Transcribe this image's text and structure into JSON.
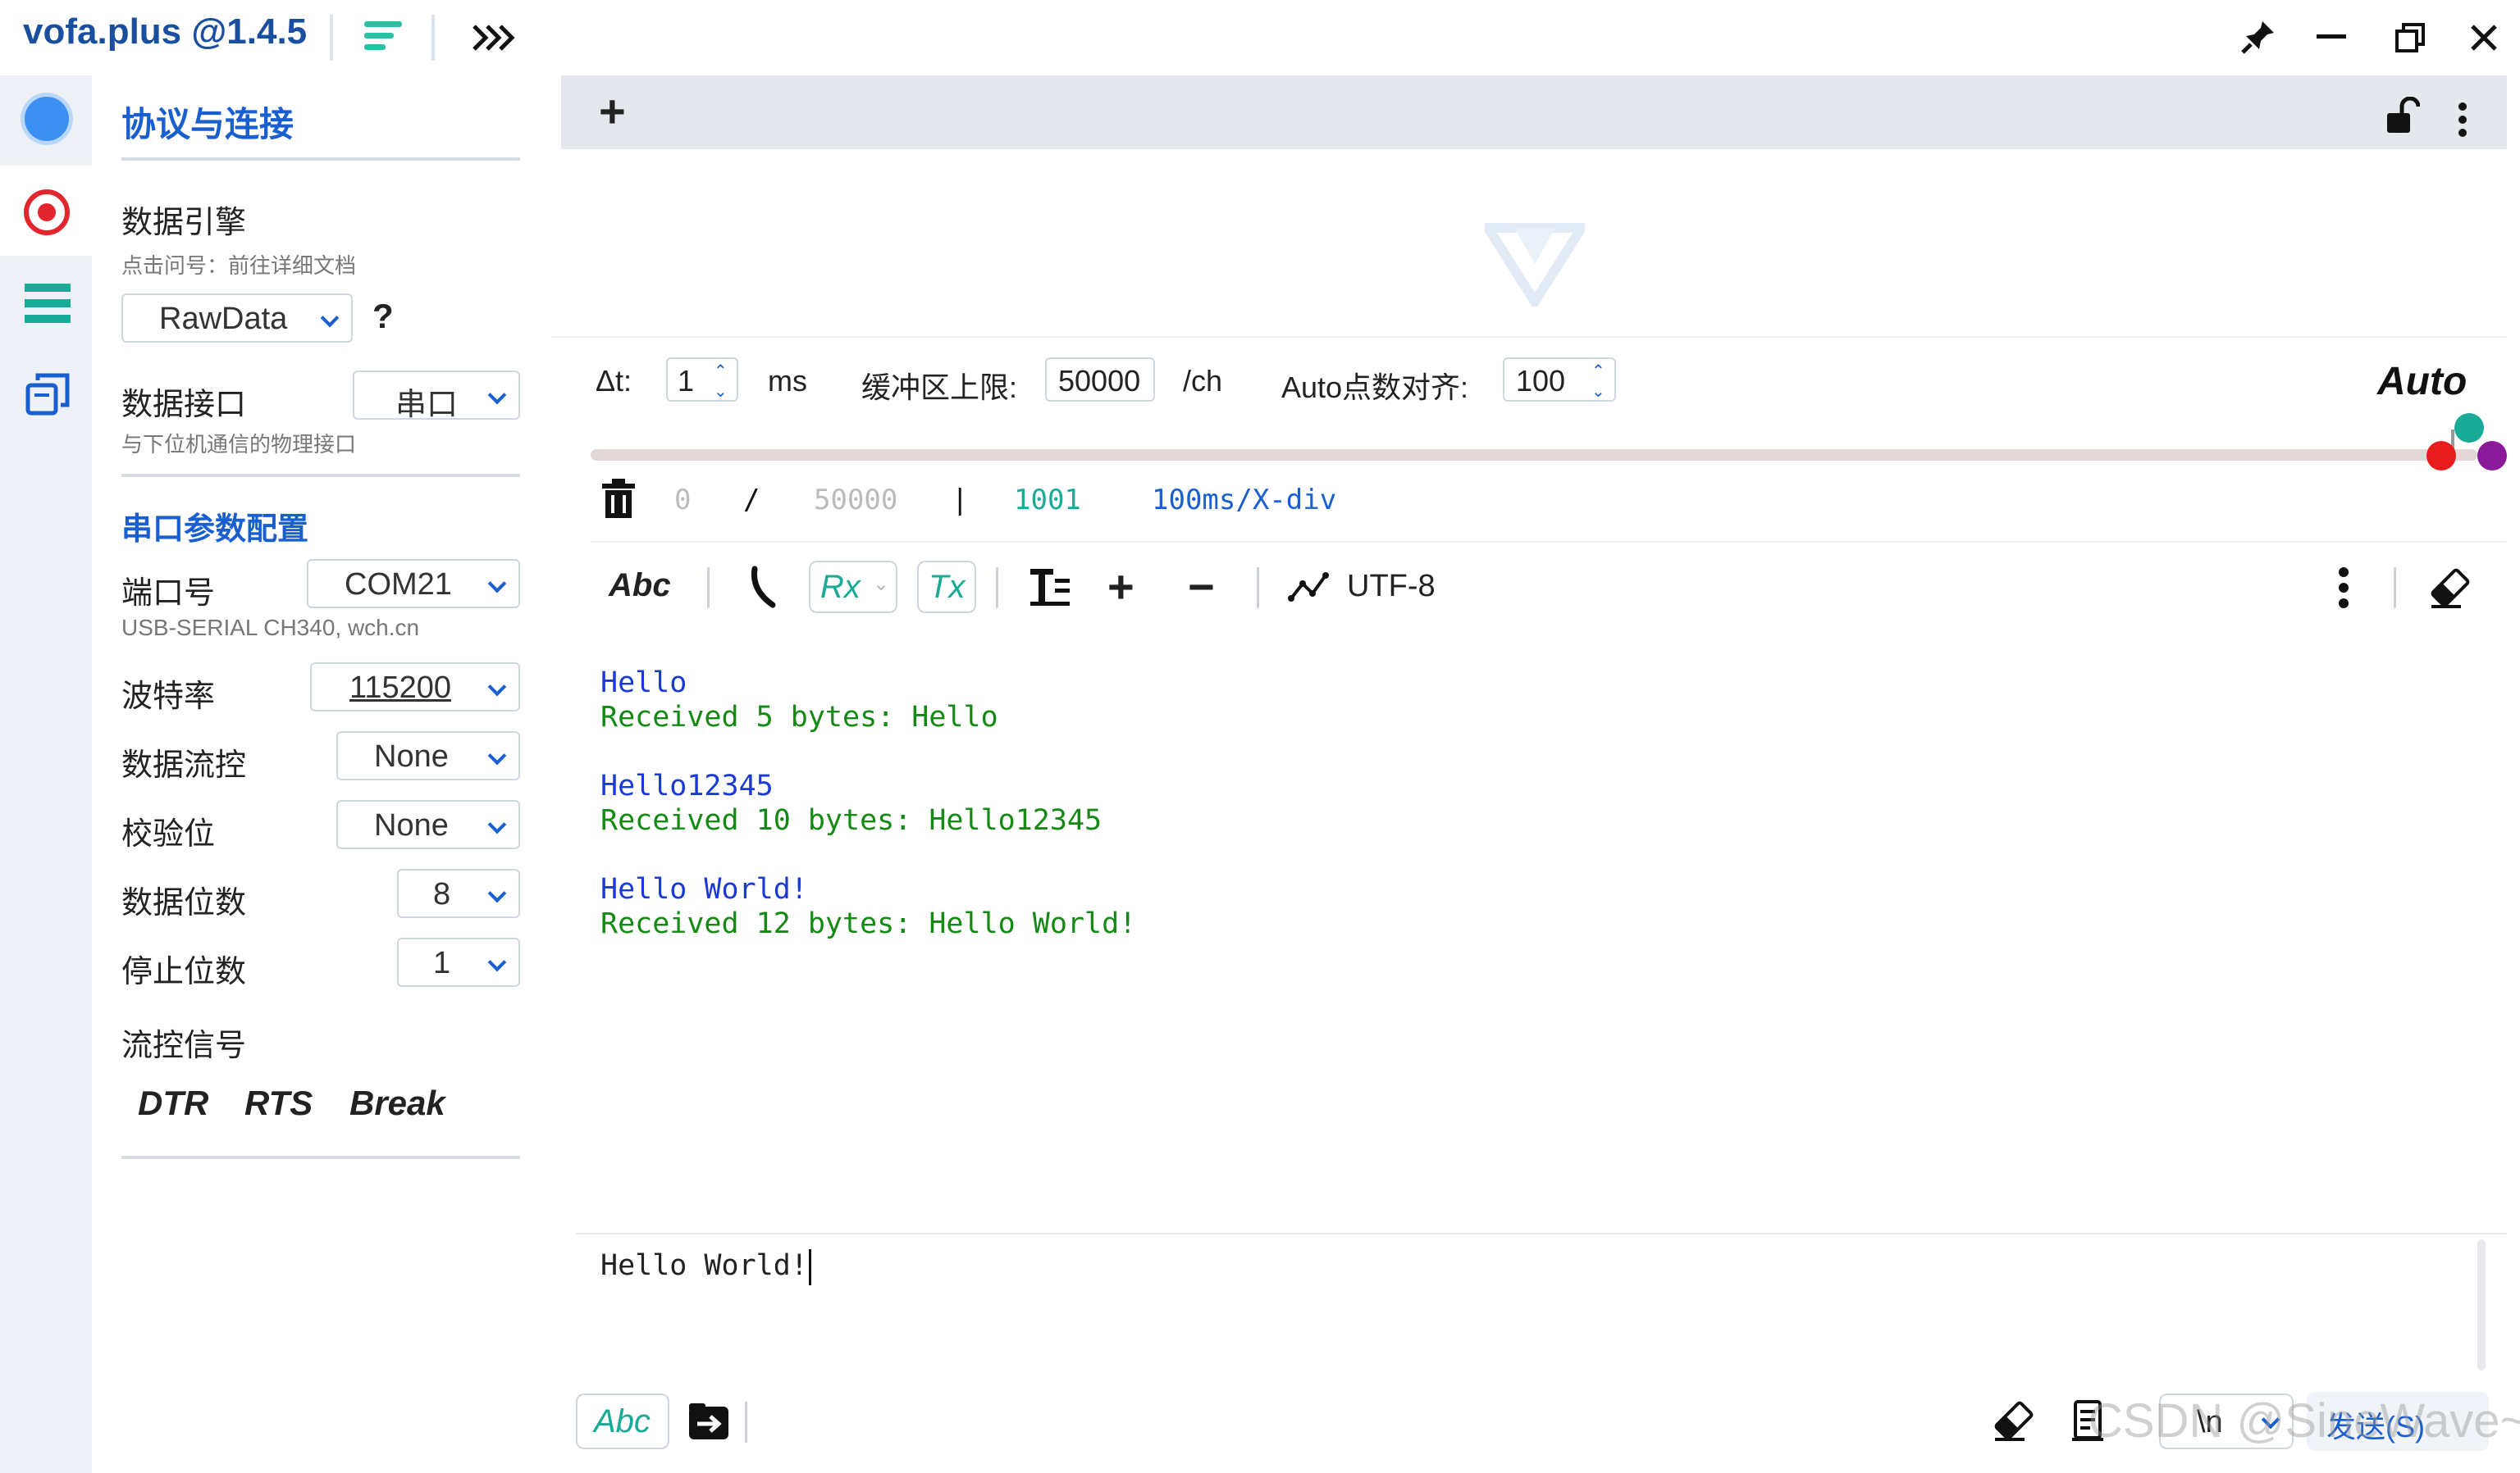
{
  "app": {
    "title": "vofa.plus @1.4.5"
  },
  "window_controls": {
    "pin": "pin-icon",
    "minimize": "minimize-icon",
    "restore": "restore-icon",
    "close": "close-icon"
  },
  "sidebar": {
    "section_title": "协议与连接",
    "engine": {
      "label": "数据引擎",
      "hint": "点击问号：前往详细文档",
      "value": "RawData",
      "help": "?"
    },
    "interface": {
      "label": "数据接口",
      "value": "串口",
      "hint": "与下位机通信的物理接口"
    },
    "serial_title": "串口参数配置",
    "port": {
      "label": "端口号",
      "value": "COM21",
      "hint": "USB-SERIAL CH340, wch.cn"
    },
    "baud": {
      "label": "波特率",
      "value": "115200"
    },
    "flow": {
      "label": "数据流控",
      "value": "None"
    },
    "parity": {
      "label": "校验位",
      "value": "None"
    },
    "databits": {
      "label": "数据位数",
      "value": "8"
    },
    "stopbits": {
      "label": "停止位数",
      "value": "1"
    },
    "signals": {
      "label": "流控信号",
      "dtr": "DTR",
      "rts": "RTS",
      "break": "Break"
    }
  },
  "tabs": {
    "add": "+"
  },
  "settings_row": {
    "dt_label": "Δt:",
    "dt_value": "1",
    "dt_unit": "ms",
    "buffer_label": "缓冲区上限:",
    "buffer_value": "50000",
    "buffer_unit": "/ch",
    "align_label": "Auto点数对齐:",
    "align_value": "100",
    "auto_label": "Auto"
  },
  "status_row": {
    "start": "0",
    "slash": "/",
    "total": "50000",
    "bar": "|",
    "count": "1001",
    "div": "100ms/X-div"
  },
  "console_toolbar": {
    "abc": "Abc",
    "rx": "Rx",
    "tx": "Tx",
    "plus": "+",
    "minus": "−",
    "encoding": "UTF-8"
  },
  "console": {
    "lines": [
      {
        "text": "Hello",
        "kind": "tx"
      },
      {
        "text": "Received 5 bytes: Hello",
        "kind": "rx"
      },
      {
        "text": "",
        "kind": "blank"
      },
      {
        "text": "Hello12345",
        "kind": "tx"
      },
      {
        "text": "Received 10 bytes: Hello12345",
        "kind": "rx"
      },
      {
        "text": "",
        "kind": "blank"
      },
      {
        "text": "Hello World!",
        "kind": "tx"
      },
      {
        "text": "Received 12 bytes: Hello World!",
        "kind": "rx"
      }
    ]
  },
  "send": {
    "input_value": "Hello World!",
    "abc": "Abc",
    "newline": "\\n",
    "send_label": "发送(S)",
    "watermark": "CSDN @SineWave~"
  },
  "colors": {
    "tx": "#1a3ad8",
    "rx": "#148a14",
    "accent": "#1a5fd0",
    "teal": "#1aaa98"
  }
}
